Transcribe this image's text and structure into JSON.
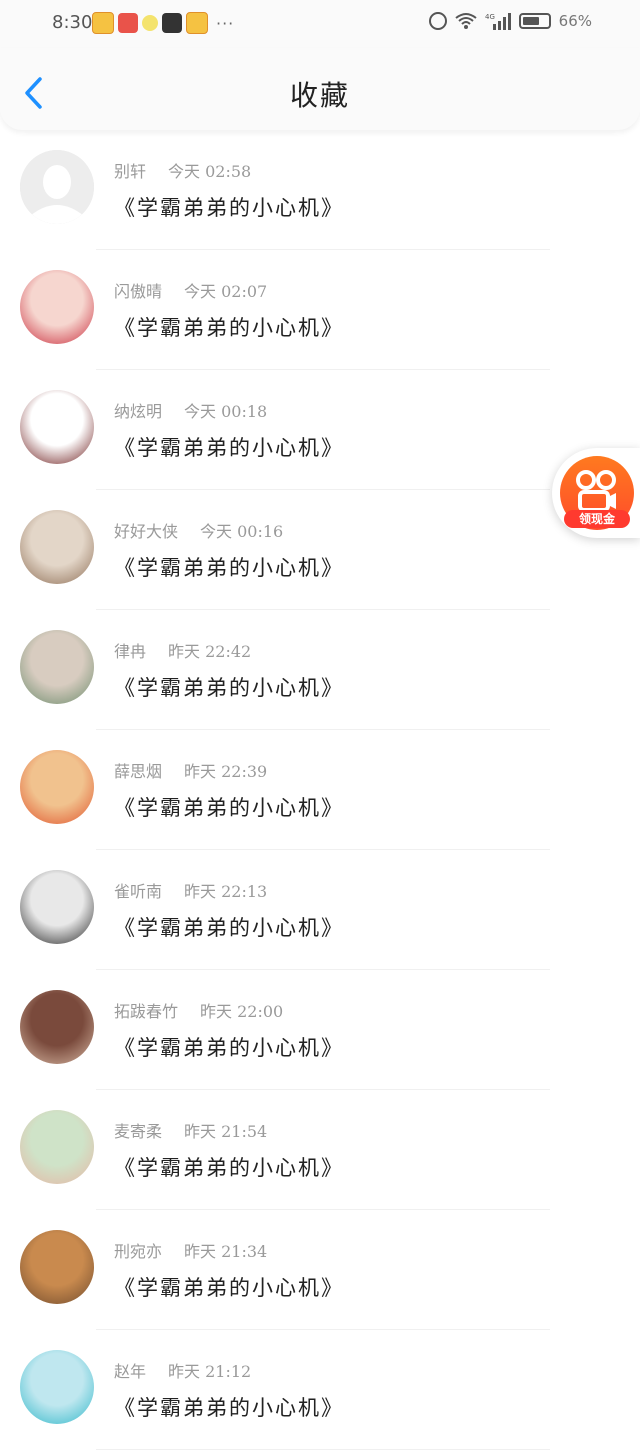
{
  "status_bar": {
    "time": "8:30",
    "more": "···",
    "network": "4G",
    "battery_percent": "66%",
    "battery_level": 0.66
  },
  "header": {
    "title": "收藏",
    "back_icon": "chevron-left-icon"
  },
  "favorites": [
    {
      "user": "别轩",
      "time": "今天  02:58",
      "book": "《学霸弟弟的小心机》"
    },
    {
      "user": "闪傲晴",
      "time": "今天  02:07",
      "book": "《学霸弟弟的小心机》"
    },
    {
      "user": "纳炫明",
      "time": "今天  00:18",
      "book": "《学霸弟弟的小心机》"
    },
    {
      "user": "好好大侠",
      "time": "今天  00:16",
      "book": "《学霸弟弟的小心机》"
    },
    {
      "user": "律冉",
      "time": "昨天  22:42",
      "book": "《学霸弟弟的小心机》"
    },
    {
      "user": "薛思烟",
      "time": "昨天  22:39",
      "book": "《学霸弟弟的小心机》"
    },
    {
      "user": "雀听南",
      "time": "昨天  22:13",
      "book": "《学霸弟弟的小心机》"
    },
    {
      "user": "拓跋春竹",
      "time": "昨天  22:00",
      "book": "《学霸弟弟的小心机》"
    },
    {
      "user": "麦寄柔",
      "time": "昨天  21:54",
      "book": "《学霸弟弟的小心机》"
    },
    {
      "user": "刑宛亦",
      "time": "昨天  21:34",
      "book": "《学霸弟弟的小心机》"
    },
    {
      "user": "赵年",
      "time": "昨天  21:12",
      "book": "《学霸弟弟的小心机》"
    }
  ],
  "floating_button": {
    "label": "领现金",
    "icon": "kuaishou-logo-icon"
  },
  "colors": {
    "accent": "#1e90ff",
    "meta_text": "#9a9a9a",
    "bonus": "#ff4b2b"
  }
}
